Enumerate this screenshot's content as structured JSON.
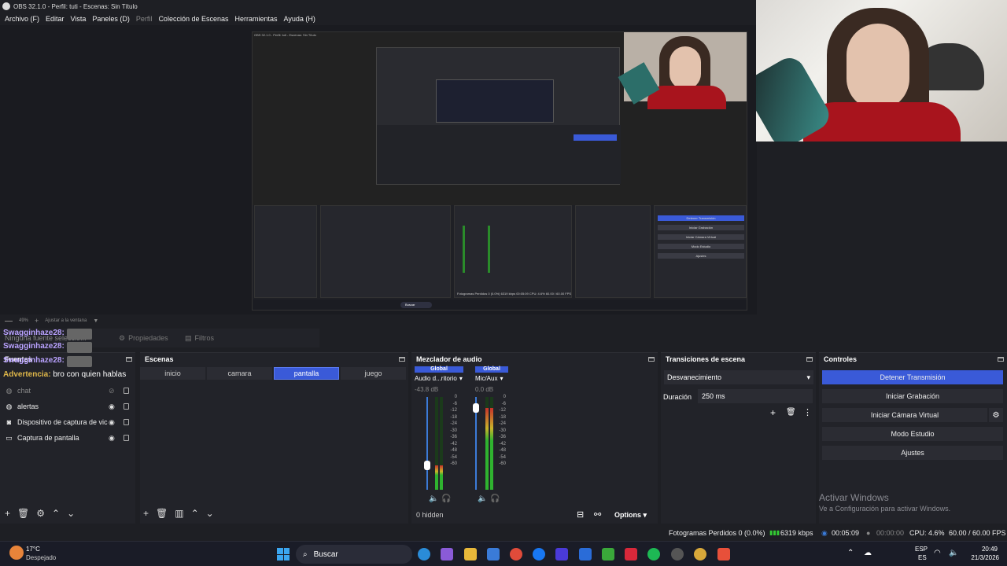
{
  "window": {
    "title": "OBS 32.1.0 - Perfil: tuti - Escenas: Sin Título"
  },
  "menu": [
    "Archivo (F)",
    "Editar",
    "Vista",
    "Paneles (D)",
    "Perfil",
    "Colección de Escenas",
    "Herramientas",
    "Ayuda (H)"
  ],
  "preview": {
    "zoom": "49%",
    "fit": "Ajustar a la ventana"
  },
  "tabs": {
    "properties": "Propiedades",
    "filters": "Filtros",
    "no_source": "Ninguna fuente seleccio..."
  },
  "chat": {
    "user": "Swagginhaze28:",
    "message": "bro con quien hablas",
    "prefix": "Advertencia:"
  },
  "sources": {
    "title": "Fuentes",
    "items": [
      {
        "name": "chat",
        "visible": false
      },
      {
        "name": "alertas",
        "visible": true
      },
      {
        "name": "Dispositivo de captura de vic",
        "visible": true
      },
      {
        "name": "Captura de pantalla",
        "visible": true
      }
    ]
  },
  "scenes": {
    "title": "Escenas",
    "items": [
      "inicio",
      "camara",
      "pantalla",
      "juego"
    ],
    "active": "pantalla"
  },
  "mixer": {
    "title": "Mezclador de audio",
    "channels": [
      {
        "label": "Global",
        "name": "Audio d...ritorio",
        "db": "-43.8 dB",
        "level": 0.26
      },
      {
        "label": "Global",
        "name": "Mic/Aux",
        "db": "0.0 dB",
        "level": 0.88
      }
    ],
    "scale": [
      "0",
      "-6",
      "-12",
      "-18",
      "-24",
      "-30",
      "-36",
      "-42",
      "-48",
      "-54",
      "-60"
    ],
    "hidden": "0 hidden",
    "options": "Options"
  },
  "transitions": {
    "title": "Transiciones de escena",
    "type": "Desvanecimiento",
    "duration_label": "Duración",
    "duration": "250 ms"
  },
  "controls": {
    "title": "Controles",
    "buttons": [
      "Detener Transmisión",
      "Iniciar Grabación",
      "Iniciar Cámara Virtual",
      "Modo Estudio",
      "Ajustes"
    ]
  },
  "watermark": {
    "line1": "Activar Windows",
    "line2": "Ve a Configuración para activar Windows."
  },
  "status": {
    "dropped": "Fotogramas Perdidos 0 (0.0%)",
    "kbps": "6319 kbps",
    "live_time": "00:05:09",
    "rec_time": "00:00:00",
    "cpu": "CPU: 4.6%",
    "fps": "60.00 / 60.00 FPS"
  },
  "taskbar": {
    "weather_temp": "17°C",
    "weather_desc": "Despejado",
    "search": "Buscar",
    "lang1": "ESP",
    "lang2": "ES",
    "time": "20:49",
    "date": "21/3/2026"
  },
  "nested": {
    "title": "OBS 32.1.0 - Perfil: tuti - Escenas: Sin Título",
    "b1": "Detener Transmisión",
    "b2": "Iniciar Grabación",
    "b3": "Iniciar Cámara Virtual",
    "b4": "Modo Estudio",
    "b5": "Ajustes",
    "dropped": "Fotogramas Perdidos 0 (0.0%)",
    "kbps": "6319 kbps",
    "time": "00:05:09",
    "cpu": "CPU: 4.6%",
    "fps": "60.00 / 60.00 FPS",
    "search": "Buscar"
  }
}
